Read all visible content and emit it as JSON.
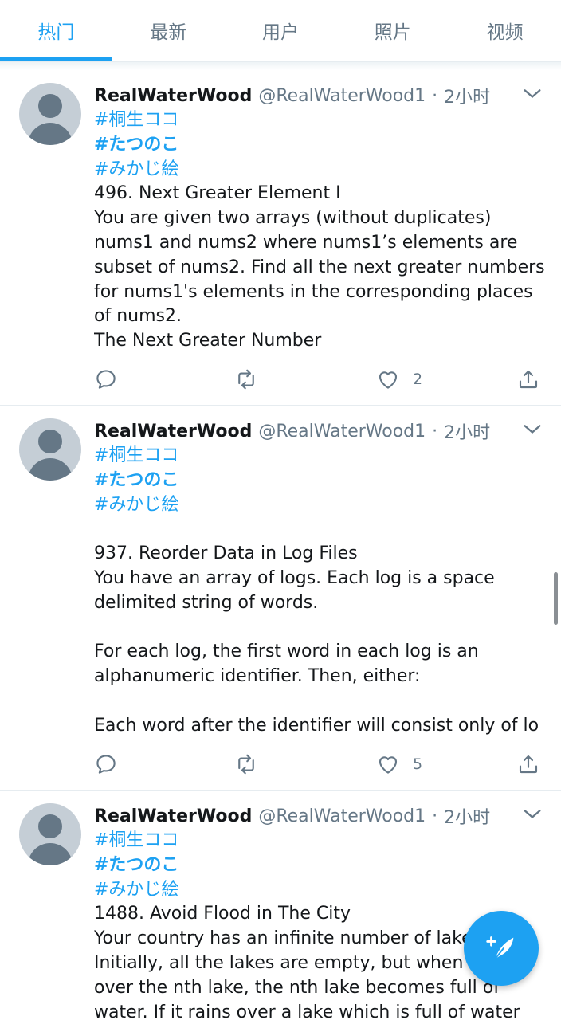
{
  "tabs": [
    {
      "label": "热门",
      "active": true
    },
    {
      "label": "最新",
      "active": false
    },
    {
      "label": "用户",
      "active": false
    },
    {
      "label": "照片",
      "active": false
    },
    {
      "label": "视频",
      "active": false
    }
  ],
  "colors": {
    "accent": "#1da1f2",
    "secondary_text": "#657786",
    "divider": "#e6ecf0"
  },
  "tweets": [
    {
      "name": "RealWaterWood",
      "handle": "@RealWaterWood1",
      "separator": "·",
      "time": "2小时",
      "tags": [
        "#桐生ココ",
        "#たつのこ",
        "#みかじ絵"
      ],
      "lines": [
        "496. Next Greater Element I",
        "You are given two arrays (without duplicates)",
        "nums1 and nums2 where nums1’s elements are",
        "subset of nums2. Find all the next greater numbers",
        "for nums1's elements in the corresponding places",
        "of nums2.",
        "The Next Greater Number"
      ],
      "likes": "2"
    },
    {
      "name": "RealWaterWood",
      "handle": "@RealWaterWood1",
      "separator": "·",
      "time": "2小时",
      "tags": [
        "#桐生ココ",
        "#たつのこ",
        "#みかじ絵"
      ],
      "lines": [
        "937. Reorder Data in Log Files",
        "You have an array of logs.  Each log is a space",
        "delimited string of words.",
        "For each log, the first word in each log is an",
        "alphanumeric identifier.  Then, either:",
        "Each word after the identifier will consist only of lo"
      ],
      "likes": "5"
    },
    {
      "name": "RealWaterWood",
      "handle": "@RealWaterWood1",
      "separator": "·",
      "time": "2小时",
      "tags": [
        "#桐生ココ",
        "#たつのこ",
        "#みかじ絵"
      ],
      "lines": [
        "1488. Avoid Flood in The City",
        "Your country has an infinite number of lake",
        "Initially, all the lakes are empty, but when it",
        "over the nth lake, the nth lake becomes full of",
        "water. If it rains over a lake which is full of water"
      ]
    }
  ],
  "icons": {
    "reply": "speech-bubble-icon",
    "retweet": "retweet-arrows-icon",
    "like": "heart-icon",
    "share": "share-upload-icon",
    "menu": "chevron-down-icon",
    "compose": "feather-plus-icon"
  }
}
